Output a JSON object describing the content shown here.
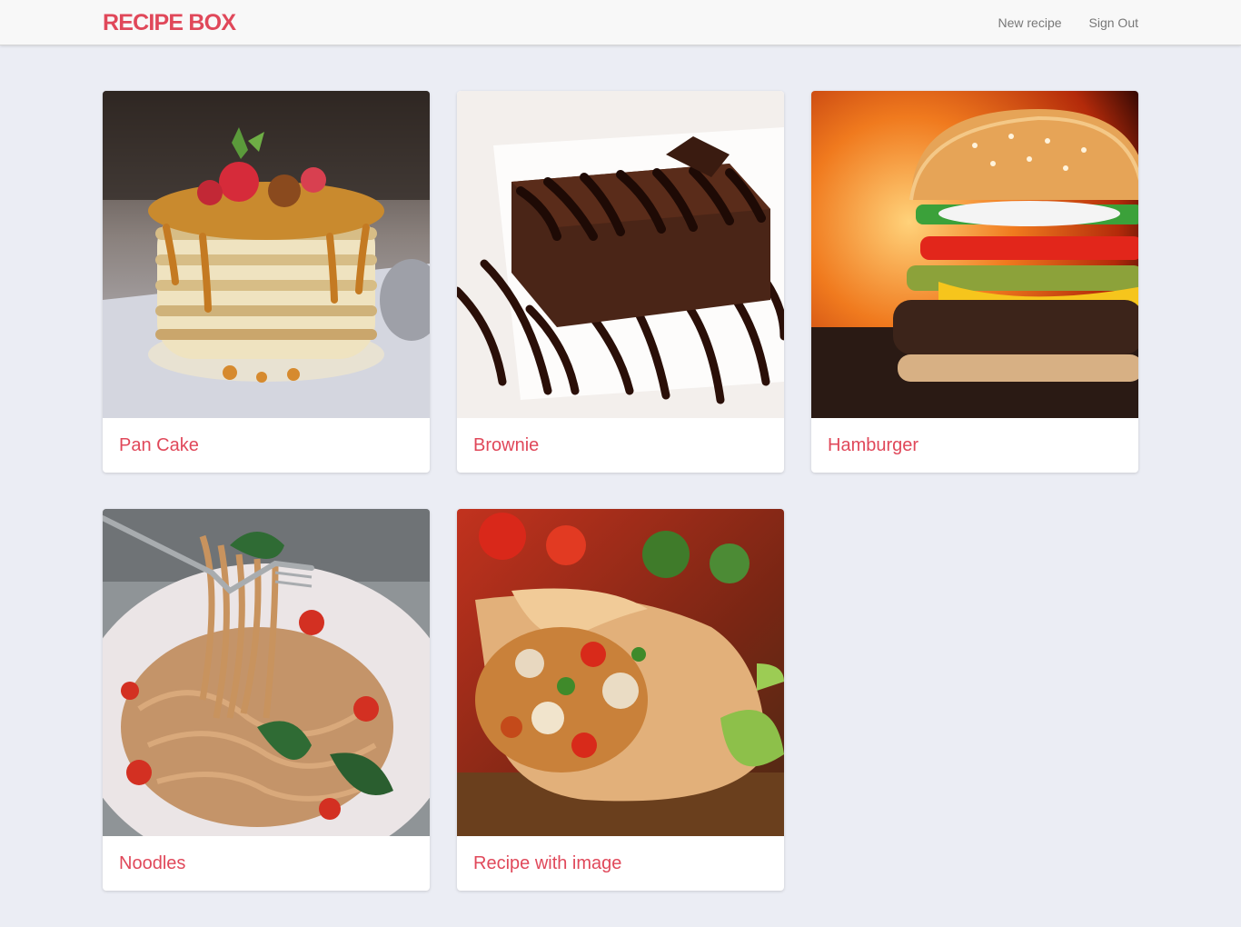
{
  "app": {
    "brand": "RECIPE BOX",
    "accent_color": "#e0485a"
  },
  "nav": {
    "new_recipe": "New recipe",
    "sign_out": "Sign Out"
  },
  "recipes": [
    {
      "title": "Pan Cake",
      "image": "pancake-stack-photo"
    },
    {
      "title": "Brownie",
      "image": "chocolate-brownie-photo"
    },
    {
      "title": "Hamburger",
      "image": "hamburger-with-flames-photo"
    },
    {
      "title": "Noodles",
      "image": "spaghetti-on-fork-photo"
    },
    {
      "title": "Recipe with image",
      "image": "burrito-wrap-photo"
    }
  ]
}
